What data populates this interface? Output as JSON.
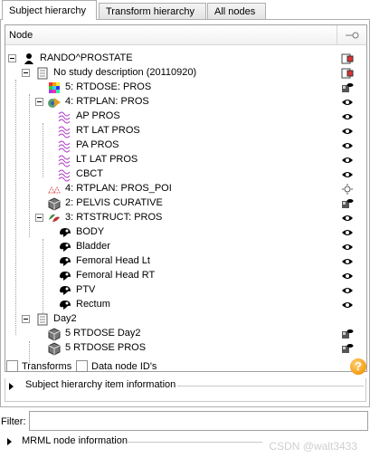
{
  "tabs": [
    {
      "label": "Subject hierarchy",
      "active": true
    },
    {
      "label": "Transform hierarchy",
      "active": false
    },
    {
      "label": "All nodes",
      "active": false
    }
  ],
  "tree": {
    "header_node": "Node",
    "header_visibility_icon": "eye-toggle-icon",
    "rows": [
      {
        "label": "RANDO^PROSTATE",
        "icon": "patient-icon",
        "vis": "study-visibility-icon"
      },
      {
        "label": "No study description (20110920)",
        "icon": "study-icon",
        "vis": "study-visibility-icon"
      },
      {
        "label": "5: RTDOSE: PROS",
        "icon": "dose-volume-icon",
        "vis": "volume-visibility-icon"
      },
      {
        "label": "4: RTPLAN: PROS",
        "icon": "plan-icon",
        "vis": "eye-icon"
      },
      {
        "label": "AP PROS",
        "icon": "beam-icon",
        "vis": "eye-icon"
      },
      {
        "label": "RT LAT PROS",
        "icon": "beam-icon",
        "vis": "eye-icon"
      },
      {
        "label": "PA PROS",
        "icon": "beam-icon",
        "vis": "eye-icon"
      },
      {
        "label": "LT LAT PROS",
        "icon": "beam-icon",
        "vis": "eye-icon"
      },
      {
        "label": "CBCT",
        "icon": "beam-icon",
        "vis": "eye-icon"
      },
      {
        "label": "4: RTPLAN: PROS_POI",
        "icon": "poi-icon",
        "vis": "sun-icon"
      },
      {
        "label": "2: PELVIS CURATIVE",
        "icon": "volume-icon",
        "vis": "volume-visibility-icon"
      },
      {
        "label": "3: RTSTRUCT: PROS",
        "icon": "segmentation-icon",
        "vis": "eye-icon"
      },
      {
        "label": "BODY",
        "icon": "segment-icon",
        "vis": "eye-icon"
      },
      {
        "label": "Bladder",
        "icon": "segment-icon",
        "vis": "eye-icon"
      },
      {
        "label": "Femoral Head Lt",
        "icon": "segment-icon",
        "vis": "eye-icon"
      },
      {
        "label": "Femoral Head RT",
        "icon": "segment-icon",
        "vis": "eye-icon"
      },
      {
        "label": "PTV",
        "icon": "segment-icon",
        "vis": "eye-icon"
      },
      {
        "label": "Rectum",
        "icon": "segment-icon",
        "vis": "eye-icon"
      },
      {
        "label": "Day2",
        "icon": "study-icon",
        "vis": "none"
      },
      {
        "label": "5 RTDOSE Day2",
        "icon": "volume-icon",
        "vis": "volume-visibility-icon"
      },
      {
        "label": "5 RTDOSE PROS",
        "icon": "volume-icon",
        "vis": "volume-visibility-icon"
      }
    ]
  },
  "options": {
    "transforms_label": "Transforms",
    "transforms_checked": false,
    "data_node_ids_label": "Data node ID's",
    "data_node_ids_checked": false,
    "help_label": "?"
  },
  "item_info": {
    "label": "Subject hierarchy item information"
  },
  "filter": {
    "label": "Filter:",
    "value": ""
  },
  "mrml_info": {
    "label": "MRML node information"
  },
  "watermark": "CSDN @walt3433",
  "colors": {
    "accent_orange": "#f39c12",
    "plan_magenta": "#b03cc8",
    "tree_line": "#a0a0a0"
  }
}
